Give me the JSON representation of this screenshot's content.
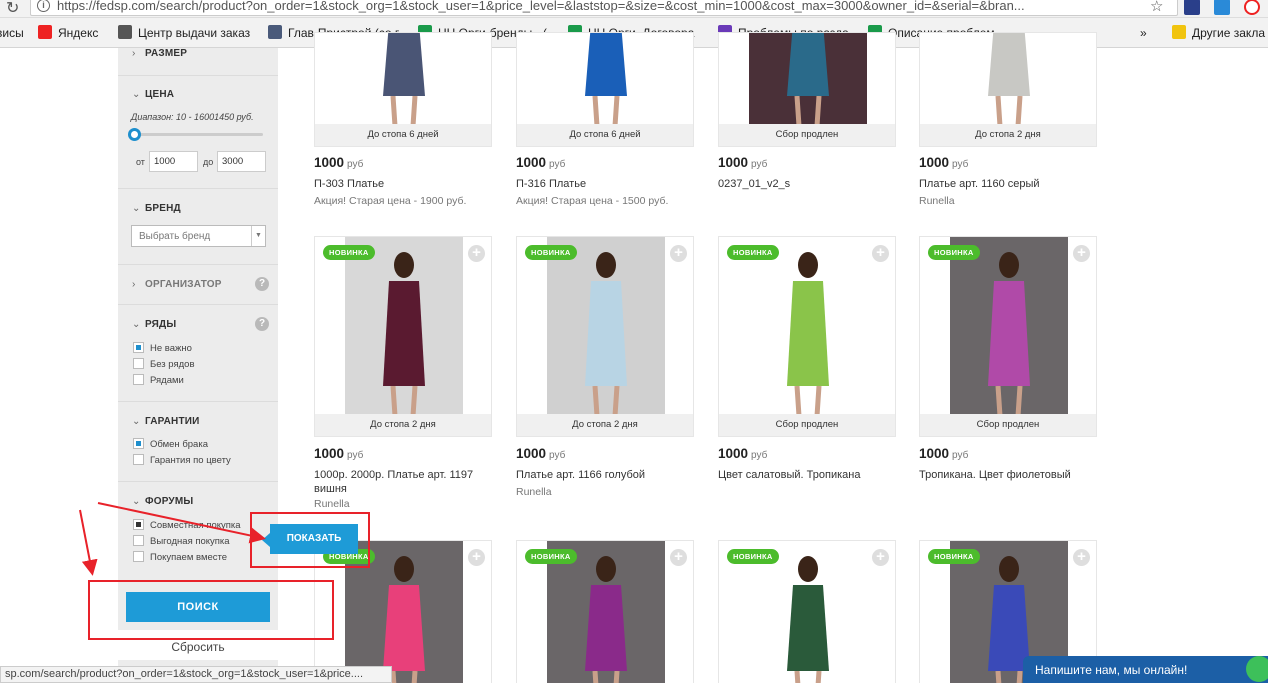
{
  "browser": {
    "url": "https://fedsp.com/search/product?on_order=1&stock_org=1&stock_user=1&price_level=&laststop=&size=&cost_min=1000&cost_max=3000&owner_id=&serial=&bran..."
  },
  "bookmarks": [
    {
      "label": "висы",
      "icon": "",
      "color": ""
    },
    {
      "label": "Яндекс",
      "icon": "yandex-icon",
      "color": "#e22"
    },
    {
      "label": "Центр выдачи заказ",
      "icon": "cart-icon",
      "color": "#555"
    },
    {
      "label": "Глав-Пристрой (со г",
      "icon": "nn-icon",
      "color": "#4a5a7a"
    },
    {
      "label": "НН Орги-бренды - (",
      "icon": "sheet-icon",
      "color": "#1a9a4a"
    },
    {
      "label": "НН Орги. Договора",
      "icon": "sheet-icon",
      "color": "#1a9a4a"
    },
    {
      "label": "Проблемы по разда",
      "icon": "form-icon",
      "color": "#6a3ab8"
    },
    {
      "label": "Описание проблем",
      "icon": "sheet-icon",
      "color": "#1a9a4a"
    },
    {
      "label": "»",
      "icon": "",
      "color": ""
    },
    {
      "label": "Другие закла",
      "icon": "folder-icon",
      "color": "#f1c40f"
    }
  ],
  "sidebar": {
    "size_label": "РАЗМЕР",
    "price_label": "ЦЕНА",
    "range_text": "Диапазон: 10 - 16001450 руб.",
    "from_label": "от",
    "from_value": "1000",
    "to_label": "до",
    "to_value": "3000",
    "brand_label": "БРЕНД",
    "brand_placeholder": "Выбрать бренд",
    "organizer_label": "ОРГАНИЗАТОР",
    "rows_label": "РЯДЫ",
    "rows_options": [
      {
        "label": "Не важно",
        "checked": true
      },
      {
        "label": "Без рядов",
        "checked": false
      },
      {
        "label": "Рядами",
        "checked": false
      }
    ],
    "guarantees_label": "ГАРАНТИИ",
    "guarantee_options": [
      {
        "label": "Обмен брака",
        "checked": true
      },
      {
        "label": "Гарантия по цвету",
        "checked": false
      }
    ],
    "forums_label": "ФОРУМЫ",
    "forum_options": [
      {
        "label": "Совместная покупка",
        "checked": true
      },
      {
        "label": "Выгодная покупка",
        "checked": false
      },
      {
        "label": "Покупаем вместе",
        "checked": false
      }
    ],
    "search_button": "ПОИСК",
    "reset_link": "Сбросить",
    "show_button": "ПОКАЗАТЬ"
  },
  "currency": "руб",
  "products": [
    {
      "status": "До стопа 6 дней",
      "price": "1000",
      "name": "П-303 Платье",
      "sub": "Акция! Старая цена - 1900 руб.",
      "badge": "",
      "bg": "#ffffff",
      "dress": "#4a5575"
    },
    {
      "status": "До стопа 6 дней",
      "price": "1000",
      "name": "П-316 Платье",
      "sub": "Акция! Старая цена - 1500 руб.",
      "badge": "",
      "bg": "#ffffff",
      "dress": "#1a5fb8"
    },
    {
      "status": "Сбор продлен",
      "price": "1000",
      "name": "0237_01_v2_s",
      "sub": "",
      "badge": "",
      "bg": "#4a3038",
      "dress": "#2a6a8a"
    },
    {
      "status": "До стопа 2 дня",
      "price": "1000",
      "name": "Платье арт. 1160 серый",
      "sub": "Runella",
      "badge": "",
      "bg": "#ffffff",
      "dress": "#c8c8c4"
    },
    {
      "status": "До стопа 2 дня",
      "price": "1000",
      "name": "1000р. 2000р. Платье арт. 1197 вишня",
      "sub": "Runella",
      "badge": "НОВИНКА",
      "bg": "#d8d8d8",
      "dress": "#5a1a30"
    },
    {
      "status": "До стопа 2 дня",
      "price": "1000",
      "name": "Платье арт. 1166 голубой",
      "sub": "Runella",
      "badge": "НОВИНКА",
      "bg": "#d0d0d0",
      "dress": "#b8d4e4"
    },
    {
      "status": "Сбор продлен",
      "price": "1000",
      "name": "Цвет салатовый. Тропикана",
      "sub": "",
      "badge": "НОВИНКА",
      "bg": "#ffffff",
      "dress": "#8ac44a"
    },
    {
      "status": "Сбор продлен",
      "price": "1000",
      "name": "Тропикана. Цвет фиолетовый",
      "sub": "",
      "badge": "НОВИНКА",
      "bg": "#6a6668",
      "dress": "#b04aa8"
    },
    {
      "status": "",
      "price": "",
      "name": "",
      "sub": "",
      "badge": "НОВИНКА",
      "bg": "#6a6668",
      "dress": "#e8407a"
    },
    {
      "status": "",
      "price": "",
      "name": "",
      "sub": "",
      "badge": "НОВИНКА",
      "bg": "#6a6668",
      "dress": "#8a2a8a"
    },
    {
      "status": "",
      "price": "",
      "name": "",
      "sub": "",
      "badge": "НОВИНКА",
      "bg": "#ffffff",
      "dress": "#2a5a3a"
    },
    {
      "status": "",
      "price": "",
      "name": "",
      "sub": "",
      "badge": "НОВИНКА",
      "bg": "#6a6668",
      "dress": "#3a4ab8"
    }
  ],
  "statusbar": "sp.com/search/product?on_order=1&stock_org=1&stock_user=1&price....",
  "chat_text": "Напишите нам, мы онлайн!",
  "colors": {
    "accent": "#1e9bd7",
    "new_badge": "#4cbc2c",
    "highlight": "#e8222a"
  }
}
